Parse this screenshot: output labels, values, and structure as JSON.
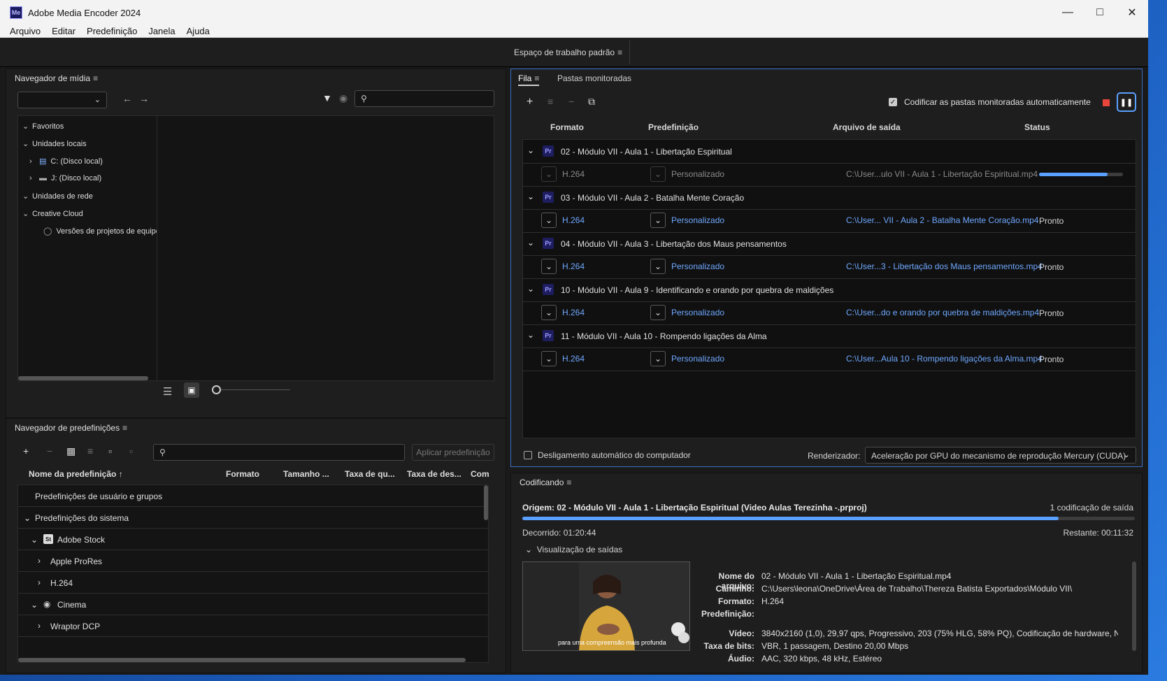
{
  "window": {
    "title": "Adobe Media Encoder 2024",
    "app_icon": "Me",
    "controls": [
      "minimize-icon",
      "maximize-icon",
      "close-icon"
    ]
  },
  "menu": [
    "Arquivo",
    "Editar",
    "Predefinição",
    "Janela",
    "Ajuda"
  ],
  "workspace": {
    "label": "Espaço de trabalho padrão"
  },
  "media_browser": {
    "title": "Navegador de mídia",
    "tree": [
      {
        "label": "Favoritos",
        "expanded": true
      },
      {
        "label": "Unidades locais",
        "expanded": true
      },
      {
        "label": "C: (Disco local)",
        "expanded": false
      },
      {
        "label": "J: (Disco local)",
        "expanded": false
      },
      {
        "label": "Unidades de rede",
        "expanded": true
      },
      {
        "label": "Creative Cloud",
        "expanded": true
      },
      {
        "label": "Versões de projetos de equipe"
      }
    ]
  },
  "preset_browser": {
    "title": "Navegador de predefinições",
    "apply_button": "Aplicar predefinição",
    "columns": [
      "Nome da predefinição",
      "Formato",
      "Tamanho ...",
      "Taxa de qu...",
      "Taxa de des...",
      "Com"
    ],
    "rows": [
      {
        "label": "Predefinições de usuário e grupos"
      },
      {
        "label": "Predefinições do sistema"
      },
      {
        "label": "Adobe Stock",
        "badge": "St"
      },
      {
        "label": "Apple ProRes"
      },
      {
        "label": "H.264"
      },
      {
        "label": "Cinema"
      },
      {
        "label": "Wraptor DCP"
      }
    ]
  },
  "queue": {
    "tabs": [
      "Fila",
      "Pastas monitoradas"
    ],
    "auto_encode_label": "Codificar as pastas monitoradas automaticamente",
    "auto_encode_checked": true,
    "columns": [
      "Formato",
      "Predefinição",
      "Arquivo de saída",
      "Status"
    ],
    "items": [
      {
        "name": "02 - Módulo VII  - Aula 1 - Libertação Espiritual",
        "format": "H.264",
        "preset": "Personalizado",
        "output": "C:\\User...ulo VII  - Aula 1 - Libertação Espiritual.mp4",
        "status": "",
        "progress": 0.82,
        "active": true
      },
      {
        "name": "03 - Módulo VII  - Aula 2 - Batalha Mente Coração",
        "format": "H.264",
        "preset": "Personalizado",
        "output": "C:\\User... VII  - Aula 2 - Batalha Mente Coração.mp4",
        "status": "Pronto"
      },
      {
        "name": "04 - Módulo VII  - Aula 3 - Libertação dos Maus pensamentos",
        "format": "H.264",
        "preset": "Personalizado",
        "output": "C:\\User...3 - Libertação dos Maus pensamentos.mp4",
        "status": "Pronto"
      },
      {
        "name": "10 - Módulo VII - Aula 9 - Identificando e orando por quebra de maldições",
        "format": "H.264",
        "preset": "Personalizado",
        "output": "C:\\User...do e orando por quebra de maldições.mp4",
        "status": "Pronto"
      },
      {
        "name": "11 - Módulo VII - Aula 10 - Rompendo ligações da Alma",
        "format": "H.264",
        "preset": "Personalizado",
        "output": "C:\\User...Aula 10 - Rompendo ligações da Alma.mp4",
        "status": "Pronto"
      }
    ],
    "shutdown_label": "Desligamento automático do computador",
    "renderer_label": "Renderizador:",
    "renderer_value": "Aceleração por GPU do mecanismo de reprodução Mercury (CUDA)"
  },
  "encoding": {
    "title": "Codificando",
    "source": "Origem: 02 - Módulo VII  - Aula 1 - Libertação Espiritual (Video Aulas Terezinha -.prproj)",
    "outputs_count": "1 codificação de saída",
    "progress": 0.875,
    "elapsed": "Decorrido: 01:20:44",
    "remaining": "Restante: 00:11:32",
    "preview_label": "Visualização de saídas",
    "thumbnail_caption": "para uma compreensão mais profunda",
    "info": [
      {
        "label": "Nome do arquivo:",
        "value": "02 - Módulo VII  - Aula 1 - Libertação Espiritual.mp4"
      },
      {
        "label": "Caminho:",
        "value": "C:\\Users\\leona\\OneDrive\\Área de Trabalho\\Thereza Batista Exportados\\Módulo VII\\"
      },
      {
        "label": "Formato:",
        "value": "H.264"
      },
      {
        "label": "Predefinição:",
        "value": ""
      },
      {
        "label": "Vídeo:",
        "value": "3840x2160 (1,0), 29,97 qps, Progressivo, 203 (75% HLG, 58% PQ), Codificação de hardware, Nvidia Co..."
      },
      {
        "label": "Taxa de bits:",
        "value": "VBR, 1 passagem, Destino 20,00 Mbps"
      },
      {
        "label": "Áudio:",
        "value": "AAC, 320 kbps, 48 kHz, Estéreo"
      }
    ]
  },
  "colors": {
    "accent": "#5aa0ff",
    "link": "#6fa8ff",
    "stop": "#e8453c"
  }
}
